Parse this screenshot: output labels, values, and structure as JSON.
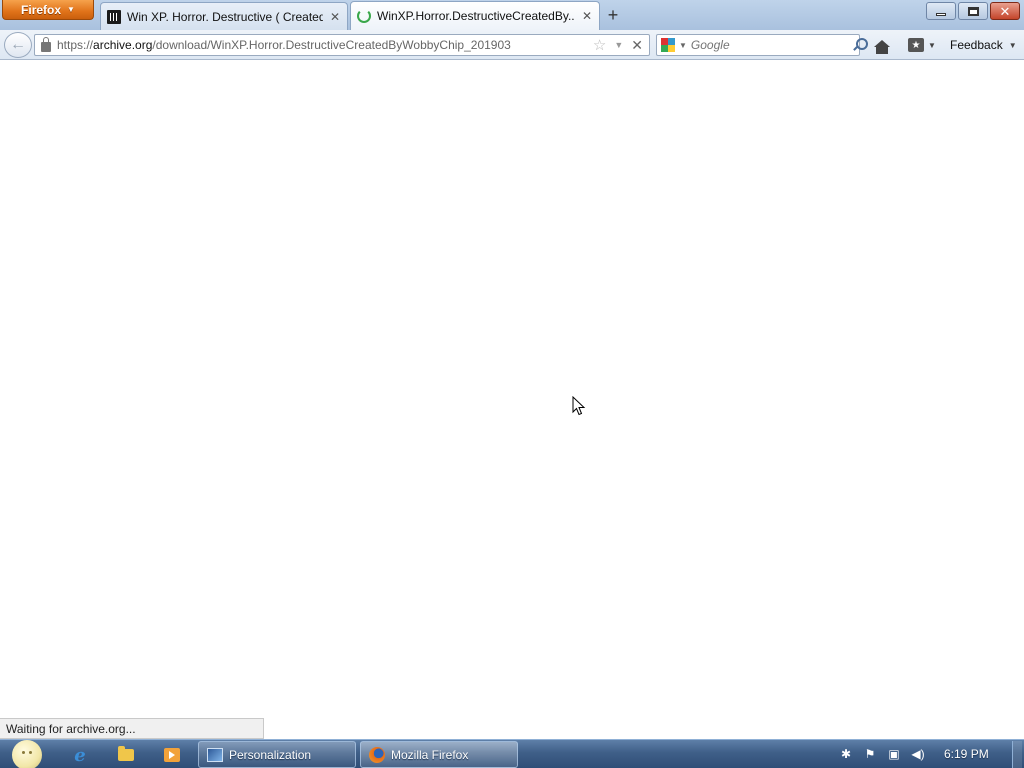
{
  "browser": {
    "app_button_label": "Firefox",
    "tabs": [
      {
        "label": "Win XP. Horror. Destructive ( Created ...",
        "icon": "archive-icon",
        "active": false
      },
      {
        "label": "WinXP.Horror.DestructiveCreatedBy...",
        "icon": "loading-spinner-icon",
        "active": true
      }
    ],
    "new_tab_label": "+",
    "url": {
      "scheme": "https://",
      "host": "archive.org",
      "path": "/download/WinXP.Horror.DestructiveCreatedByWobbyChip_201903"
    },
    "search": {
      "engine": "Google",
      "placeholder": "Google"
    },
    "feedback_label": "Feedback",
    "status_text": "Waiting for archive.org..."
  },
  "taskbar": {
    "quick_launch": [
      "internet-explorer-icon",
      "folder-icon",
      "media-player-icon"
    ],
    "buttons": [
      {
        "label": "Personalization",
        "icon": "personalization-icon"
      },
      {
        "label": "Mozilla Firefox",
        "icon": "firefox-icon"
      }
    ],
    "tray_icons": [
      "network-icon",
      "action-center-flag-icon",
      "display-icon",
      "volume-icon"
    ],
    "clock": "6:19 PM"
  },
  "colors": {
    "firefox_orange": "#e0731a",
    "taskbar_blue": "#3f5f88",
    "chrome_blue": "#bfd3ea"
  }
}
